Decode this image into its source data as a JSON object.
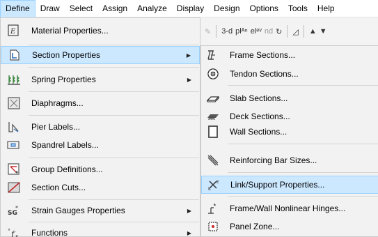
{
  "menubar": {
    "items": [
      "Define",
      "Draw",
      "Select",
      "Assign",
      "Analyze",
      "Display",
      "Design",
      "Options",
      "Tools",
      "Help"
    ]
  },
  "toolbar": {
    "text_3d": "3-d",
    "text_plan": "plᴬⁿ",
    "text_elev": "elᵉᵛ",
    "text_nd": "nd"
  },
  "define_menu": {
    "items": [
      {
        "label": "Material Properties...",
        "icon": "material-icon",
        "submenu": false
      },
      {
        "label": "Section Properties",
        "icon": "section-properties-icon",
        "submenu": true
      },
      {
        "label": "Spring Properties",
        "icon": "spring-icon",
        "submenu": true
      },
      {
        "label": "Diaphragms...",
        "icon": "diaphragm-icon",
        "submenu": false
      },
      {
        "label": "Pier Labels...",
        "icon": "pier-icon",
        "submenu": false
      },
      {
        "label": "Spandrel Labels...",
        "icon": "spandrel-icon",
        "submenu": false
      },
      {
        "label": "Group Definitions...",
        "icon": "group-icon",
        "submenu": false
      },
      {
        "label": "Section Cuts...",
        "icon": "section-cut-icon",
        "submenu": false
      },
      {
        "label": "Strain Gauges Properties",
        "icon": "strain-gauge-icon",
        "submenu": true
      },
      {
        "label": "Functions",
        "icon": "functions-icon",
        "submenu": true
      }
    ]
  },
  "section_submenu": {
    "items": [
      {
        "label": "Frame Sections...",
        "icon": "frame-section-icon"
      },
      {
        "label": "Tendon Sections...",
        "icon": "tendon-icon"
      },
      {
        "label": "Slab Sections...",
        "icon": "slab-icon"
      },
      {
        "label": "Deck Sections...",
        "icon": "deck-icon"
      },
      {
        "label": "Wall Sections...",
        "icon": "wall-icon"
      },
      {
        "label": "Reinforcing Bar Sizes...",
        "icon": "rebar-icon"
      },
      {
        "label": "Link/Support Properties...",
        "icon": "link-support-icon"
      },
      {
        "label": "Frame/Wall Nonlinear Hinges...",
        "icon": "hinge-icon"
      },
      {
        "label": "Panel Zone...",
        "icon": "panel-zone-icon"
      }
    ]
  }
}
